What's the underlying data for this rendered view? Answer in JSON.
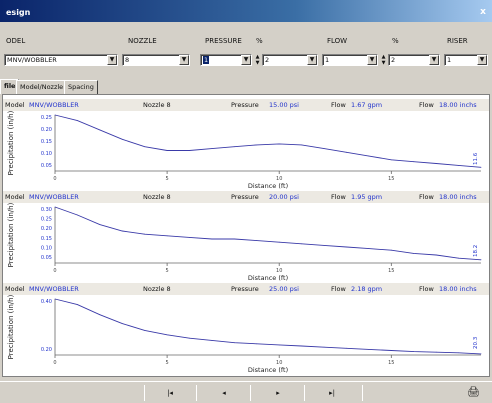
{
  "window": {
    "title": "esign",
    "close_label": "x"
  },
  "params": {
    "labels": [
      "ODEL",
      "NOZZLE",
      "PRESSURE",
      "%",
      "FLOW",
      "%",
      "RISER"
    ],
    "values": {
      "model": "MNV/WOBBLER",
      "nozzle": "8",
      "pressure": "1",
      "pressure_pct": "2",
      "flow": "1",
      "flow_pct": "2",
      "riser": "1"
    }
  },
  "tabs": [
    "file",
    "Model/Nozzle",
    "Spacing"
  ],
  "charts": [
    {
      "model_label": "Model",
      "model_value": "MNV/WOBBLER",
      "nozzle": "Nozzle 8",
      "pressure_label": "Pressure",
      "pressure_value": "15.00 psi",
      "flow_label": "Flow",
      "flow_value": "1.67 gpm",
      "riser_label": "Flow",
      "riser_value": "18.00 inchs",
      "ylabel": "Precipitation (in/h)",
      "xlabel": "Distance (ft)",
      "yticks": [
        "0.25",
        "0.20",
        "0.15",
        "0.10",
        "0.05"
      ],
      "xticks": [
        "0",
        "5",
        "10",
        "15"
      ],
      "end_label": "11.6",
      "color": "#3a3aa8"
    },
    {
      "model_label": "Model",
      "model_value": "MNV/WOBBLER",
      "nozzle": "Nozzle 8",
      "pressure_label": "Pressure",
      "pressure_value": "20.00 psi",
      "flow_label": "Flow",
      "flow_value": "1.95 gpm",
      "riser_label": "Flow",
      "riser_value": "18.00 inchs",
      "ylabel": "Precipitation (in/h)",
      "xlabel": "Distance (ft)",
      "yticks": [
        "0.30",
        "0.25",
        "0.20",
        "0.15",
        "0.10",
        "0.05"
      ],
      "xticks": [
        "0",
        "5",
        "10",
        "15"
      ],
      "end_label": "18.2",
      "color": "#3a3aa8"
    },
    {
      "model_label": "Model",
      "model_value": "MNV/WOBBLER",
      "nozzle": "Nozzle 8",
      "pressure_label": "Pressure",
      "pressure_value": "25.00 psi",
      "flow_label": "Flow",
      "flow_value": "2.18 gpm",
      "riser_label": "Flow",
      "riser_value": "18.00 inchs",
      "ylabel": "Precipitation (in/h)",
      "xlabel": "Distance (ft)",
      "yticks": [
        "0.40",
        "0.20"
      ],
      "xticks": [
        "0",
        "5",
        "10",
        "15"
      ],
      "end_label": "20.3",
      "color": "#3a3aa8"
    }
  ],
  "chart_data": [
    {
      "type": "line",
      "xlabel": "Distance (ft)",
      "ylabel": "Precipitation (in/h)",
      "xlim": [
        0,
        19
      ],
      "ylim": [
        0,
        0.3
      ],
      "x": [
        0,
        1,
        2,
        3,
        4,
        5,
        6,
        7,
        8,
        9,
        10,
        11,
        12,
        13,
        14,
        15,
        16,
        17,
        18,
        19
      ],
      "y": [
        0.3,
        0.27,
        0.22,
        0.17,
        0.13,
        0.11,
        0.11,
        0.12,
        0.13,
        0.14,
        0.145,
        0.14,
        0.12,
        0.1,
        0.08,
        0.06,
        0.05,
        0.04,
        0.03,
        0.02
      ]
    },
    {
      "type": "line",
      "xlabel": "Distance (ft)",
      "ylabel": "Precipitation (in/h)",
      "xlim": [
        0,
        19
      ],
      "ylim": [
        0,
        0.35
      ],
      "x": [
        0,
        1,
        2,
        3,
        4,
        5,
        6,
        7,
        8,
        9,
        10,
        11,
        12,
        13,
        14,
        15,
        16,
        17,
        18,
        19
      ],
      "y": [
        0.35,
        0.3,
        0.24,
        0.2,
        0.18,
        0.17,
        0.16,
        0.15,
        0.15,
        0.14,
        0.13,
        0.12,
        0.11,
        0.1,
        0.09,
        0.08,
        0.06,
        0.05,
        0.03,
        0.02
      ]
    },
    {
      "type": "line",
      "xlabel": "Distance (ft)",
      "ylabel": "Precipitation (in/h)",
      "xlim": [
        0,
        19
      ],
      "ylim": [
        0,
        0.5
      ],
      "x": [
        0,
        1,
        2,
        3,
        4,
        5,
        6,
        7,
        8,
        9,
        10,
        11,
        12,
        13,
        14,
        15,
        16,
        17,
        18,
        19
      ],
      "y": [
        0.5,
        0.45,
        0.36,
        0.28,
        0.22,
        0.18,
        0.15,
        0.13,
        0.11,
        0.1,
        0.09,
        0.08,
        0.07,
        0.06,
        0.05,
        0.04,
        0.03,
        0.025,
        0.02,
        0.01
      ]
    }
  ],
  "bottom_nav": [
    "|◂",
    "◂",
    "▸",
    "▸|"
  ]
}
